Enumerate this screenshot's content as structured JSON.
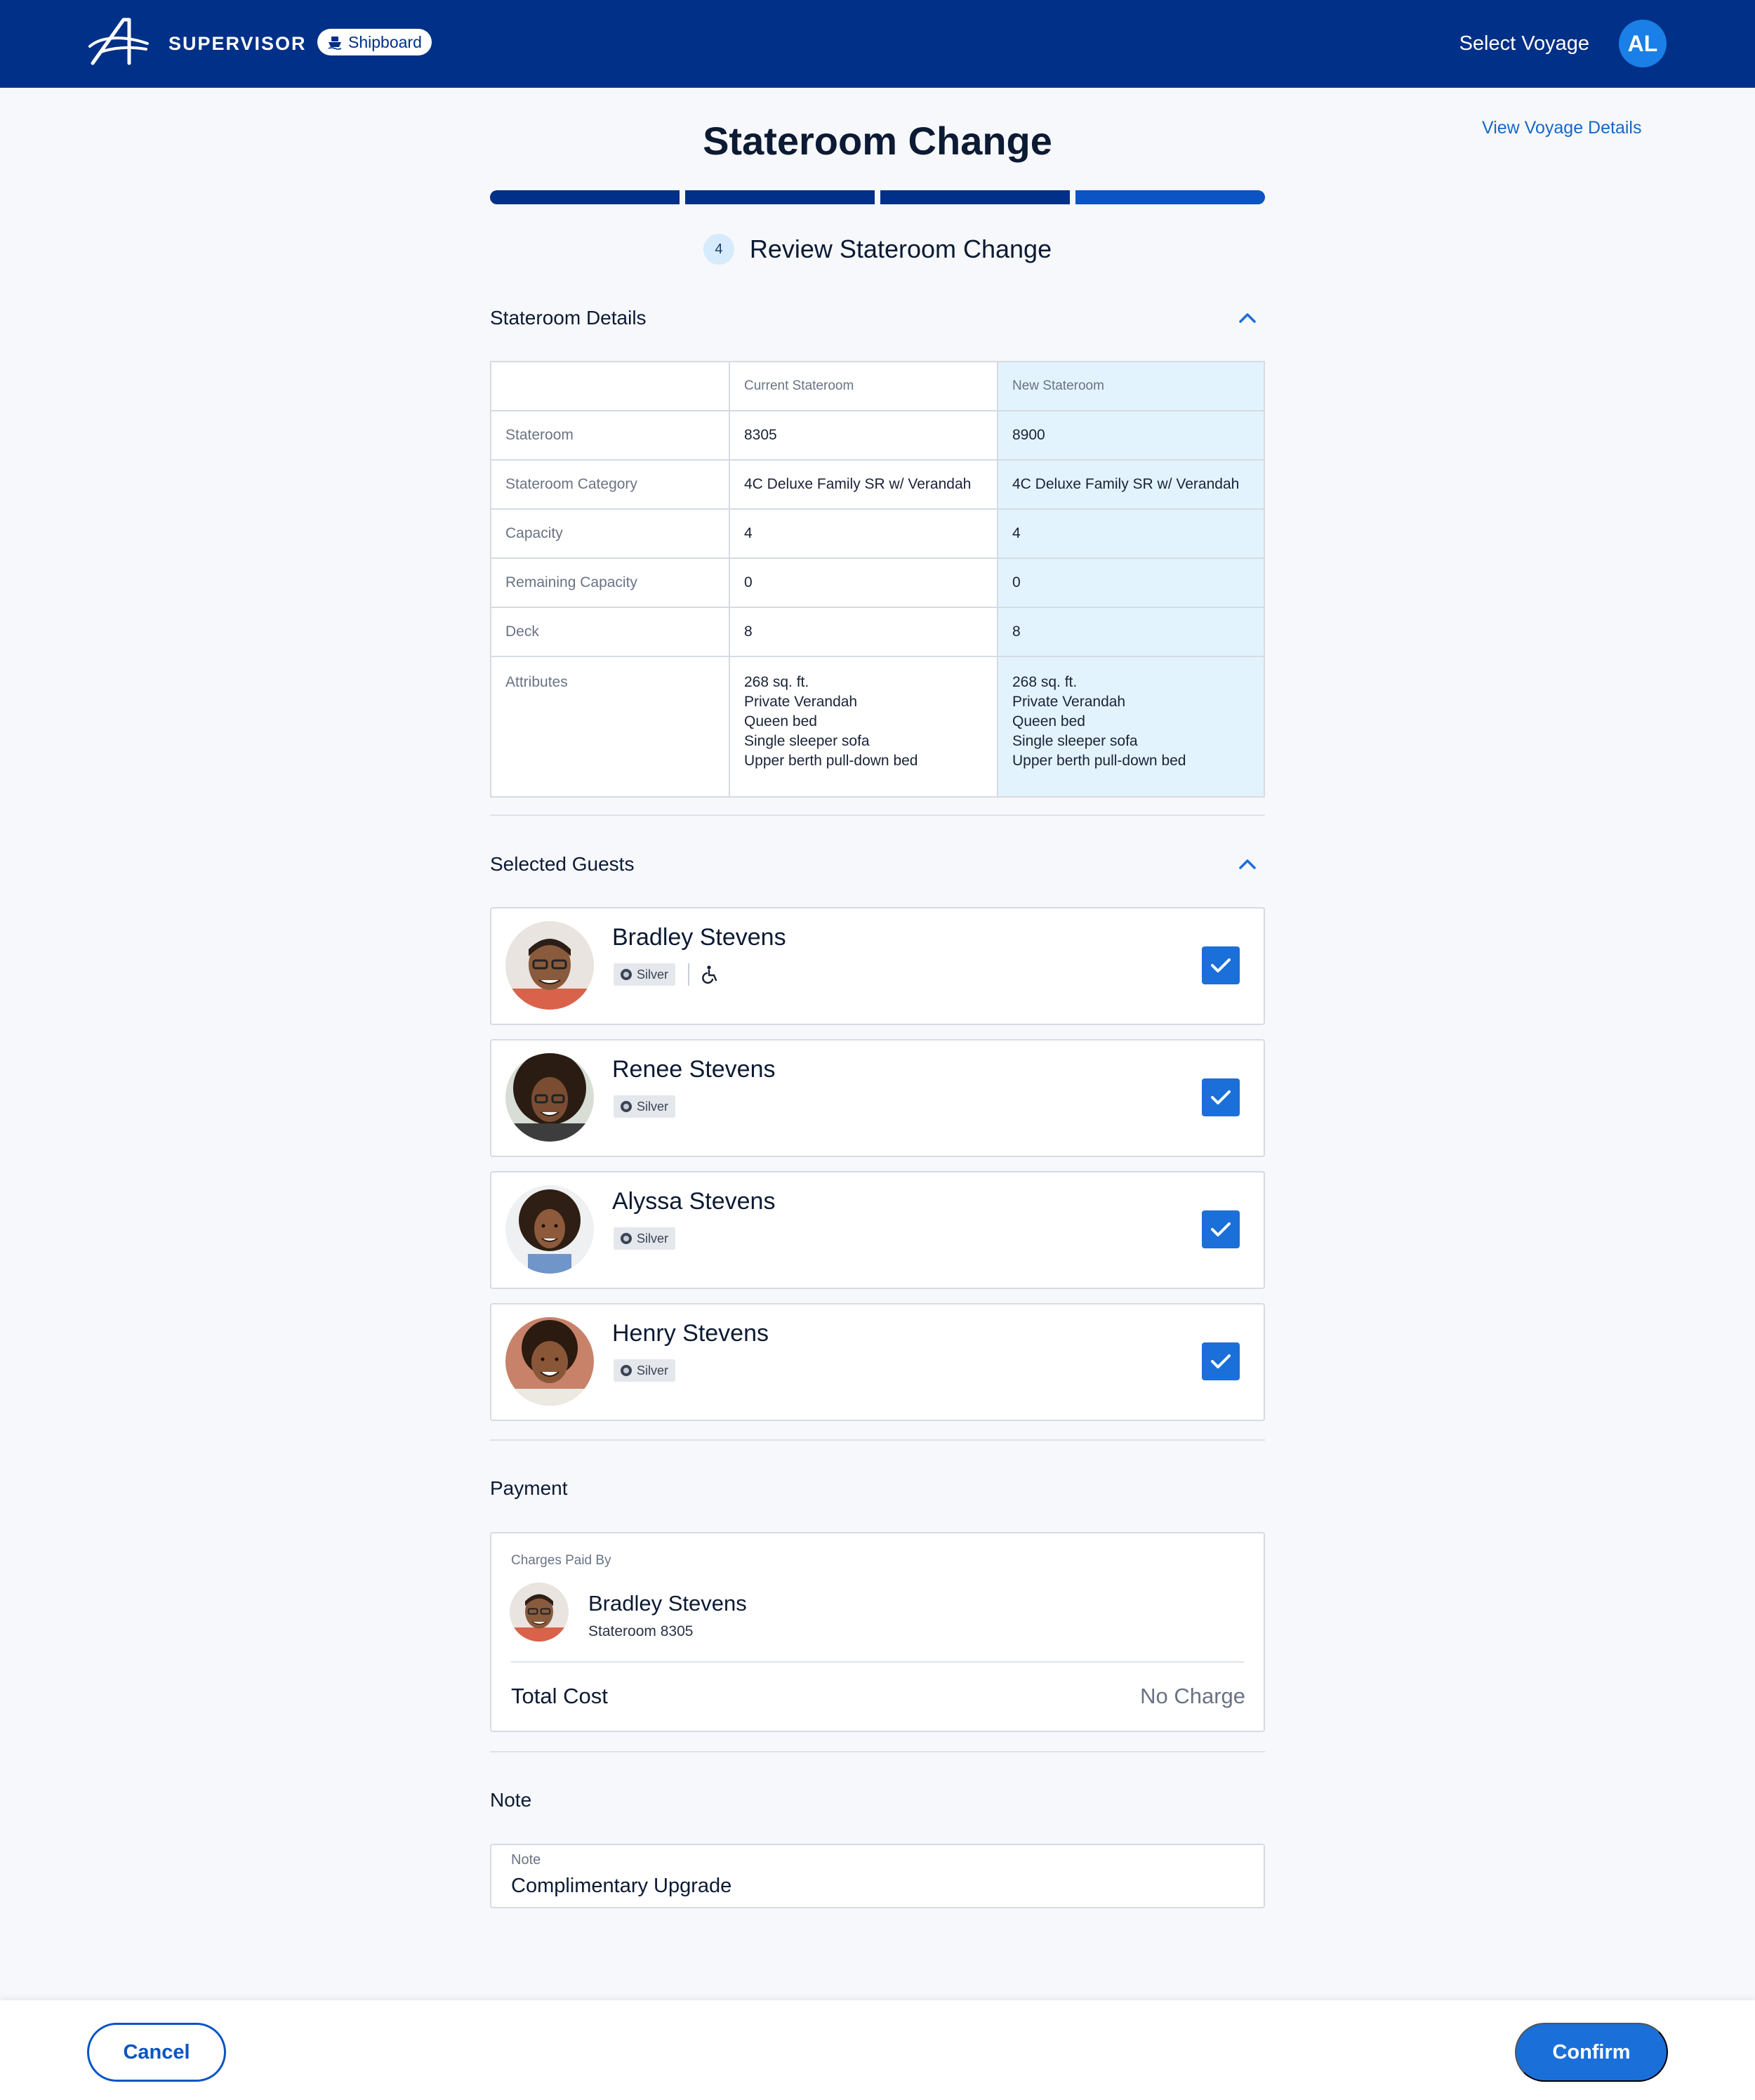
{
  "header": {
    "app_name": "SUPERVISOR",
    "context_badge": "Shipboard",
    "select_voyage": "Select Voyage",
    "user_initials": "AL"
  },
  "page": {
    "title": "Stateroom Change",
    "view_voyage_details": "View Voyage Details",
    "progress": {
      "steps_total": 4,
      "steps_complete": 4
    },
    "step_number": "4",
    "step_label": "Review Stateroom Change"
  },
  "stateroom_details": {
    "title": "Stateroom Details",
    "columns": [
      "",
      "Current Stateroom",
      "New Stateroom"
    ],
    "rows": [
      {
        "label": "Stateroom",
        "current": "8305",
        "new": "8900"
      },
      {
        "label": "Stateroom Category",
        "current": "4C Deluxe Family SR w/ Verandah",
        "new": "4C Deluxe Family SR w/ Verandah"
      },
      {
        "label": "Capacity",
        "current": "4",
        "new": "4"
      },
      {
        "label": "Remaining Capacity",
        "current": "0",
        "new": "0"
      },
      {
        "label": "Deck",
        "current": "8",
        "new": "8"
      }
    ],
    "attributes": {
      "label": "Attributes",
      "current": [
        "268 sq. ft.",
        "Private Verandah",
        "Queen bed",
        "Single sleeper sofa",
        "Upper berth pull-down bed"
      ],
      "new": [
        "268 sq. ft.",
        "Private Verandah",
        "Queen bed",
        "Single sleeper sofa",
        "Upper berth pull-down bed"
      ]
    }
  },
  "guests": {
    "title": "Selected Guests",
    "items": [
      {
        "name": "Bradley Stevens",
        "tier": "Silver",
        "accessible": true,
        "checked": true
      },
      {
        "name": "Renee Stevens",
        "tier": "Silver",
        "accessible": false,
        "checked": true
      },
      {
        "name": "Alyssa Stevens",
        "tier": "Silver",
        "accessible": false,
        "checked": true
      },
      {
        "name": "Henry Stevens",
        "tier": "Silver",
        "accessible": false,
        "checked": true
      }
    ]
  },
  "payment": {
    "title": "Payment",
    "paid_by_label": "Charges Paid By",
    "payer_name": "Bradley Stevens",
    "payer_room": "Stateroom 8305",
    "total_label": "Total Cost",
    "total_value": "No Charge"
  },
  "note": {
    "title": "Note",
    "field_label": "Note",
    "value": "Complimentary Upgrade"
  },
  "footer": {
    "cancel": "Cancel",
    "confirm": "Confirm"
  },
  "colors": {
    "header_bg": "#003087",
    "accent": "#1a6fd9",
    "new_column_bg": "#e3f3fd"
  }
}
